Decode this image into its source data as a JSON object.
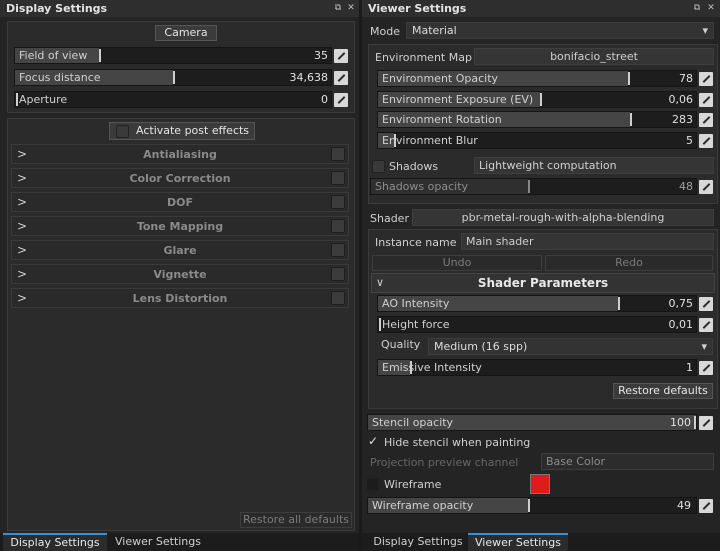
{
  "display": {
    "title": "Display Settings",
    "icons": [
      "float-icon",
      "close-icon"
    ],
    "camera_label": "Camera",
    "camera_fields": [
      {
        "label": "Field of view",
        "value": "35",
        "fill": 0.27
      },
      {
        "label": "Focus distance",
        "value": "34,638",
        "fill": 0.47
      },
      {
        "label": "Aperture",
        "value": "0",
        "fill": 0.0
      }
    ],
    "activate_label": "Activate post effects",
    "effects": [
      "Antialiasing",
      "Color Correction",
      "DOF",
      "Tone Mapping",
      "Glare",
      "Vignette",
      "Lens Distortion"
    ],
    "restore_all": "Restore all defaults",
    "tabs": [
      {
        "label": "Display Settings",
        "active": true
      },
      {
        "label": "Viewer Settings",
        "active": false
      }
    ]
  },
  "viewer": {
    "title": "Viewer Settings",
    "mode_label": "Mode",
    "mode_value": "Material",
    "env_map_label": "Environment Map",
    "env_map_value": "bonifacio_street",
    "env_sliders": [
      {
        "label": "Environment Opacity",
        "value": "78",
        "fill": 0.78
      },
      {
        "label": "Environment Exposure (EV)",
        "value": "0,06",
        "fill": 0.505
      },
      {
        "label": "Environment Rotation",
        "value": "283",
        "fill": 0.786
      },
      {
        "label": "Environment Blur",
        "value": "5",
        "fill": 0.05
      }
    ],
    "shadows_label": "Shadows",
    "shadows_mode": "Lightweight computation",
    "shadows_opacity_label": "Shadows opacity",
    "shadows_opacity_value": "48",
    "shadows_opacity_fill": 0.47,
    "shader_label": "Shader",
    "shader_value": "pbr-metal-rough-with-alpha-blending",
    "instance_label": "Instance name",
    "instance_value": "Main shader",
    "undo_label": "Undo",
    "redo_label": "Redo",
    "shader_params_label": "Shader Parameters",
    "ao_label": "AO Intensity",
    "ao_value": "0,75",
    "ao_fill": 0.75,
    "height_label": "Height force",
    "height_value": "0,01",
    "height_fill": 0.0,
    "quality_label": "Quality",
    "quality_value": "Medium (16 spp)",
    "emissive_label": "Emissive Intensity",
    "emissive_value": "1",
    "emissive_fill": 0.1,
    "restore_defaults": "Restore defaults",
    "stencil_label": "Stencil opacity",
    "stencil_value": "100",
    "stencil_fill": 1.0,
    "hide_stencil_label": "Hide stencil when painting",
    "projection_label": "Projection preview channel",
    "projection_value": "Base Color",
    "wireframe_label": "Wireframe",
    "wireframe_color": "#e01b1b",
    "wireframe_opacity_label": "Wireframe opacity",
    "wireframe_opacity_value": "49",
    "wireframe_opacity_fill": 0.48,
    "tabs": [
      {
        "label": "Display Settings",
        "active": false
      },
      {
        "label": "Viewer Settings",
        "active": true
      }
    ]
  }
}
